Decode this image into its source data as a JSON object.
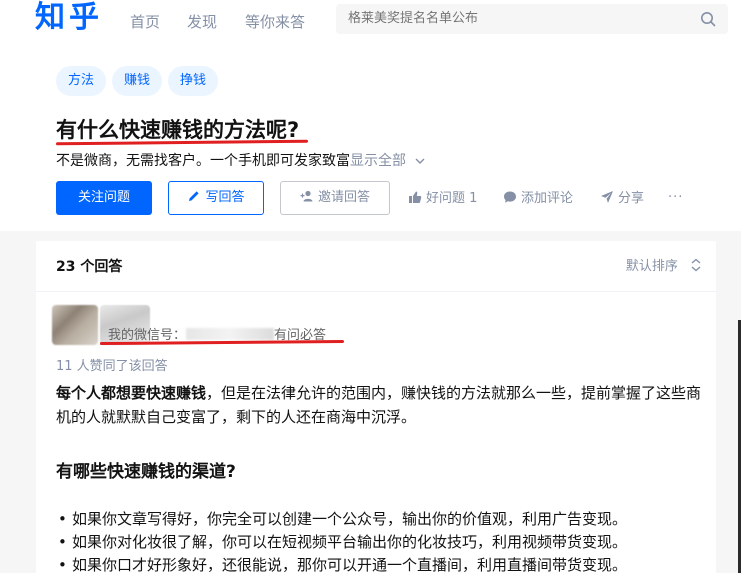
{
  "nav": {
    "logo": "知乎",
    "items": [
      "首页",
      "发现",
      "等你来答"
    ],
    "search_placeholder": "格莱美奖提名名单公布"
  },
  "question": {
    "tags": [
      "方法",
      "赚钱",
      "挣钱"
    ],
    "title": "有什么快速赚钱的方法呢?",
    "description": "不是微商，无需找客户。一个手机即可发家致富",
    "show_all": "显示全部",
    "follow_label": "关注问题",
    "write_label": "写回答",
    "invite_label": "邀请回答",
    "good_question_label": "好问题 1",
    "comment_label": "添加评论",
    "share_label": "分享",
    "more_label": "···"
  },
  "answers": {
    "count_label": "23 个回答",
    "sort_label": "默认排序",
    "first": {
      "bio_prefix": "我的微信号：",
      "bio_suffix": "有问必答",
      "votes": "11 人赞同了该回答",
      "paragraph_bold": "每个人都想要快速赚钱",
      "paragraph_rest": "，但是在法律允许的范围内，赚快钱的方法就那么一些，提前掌握了这些商机的人就默默自己变富了，剩下的人还在商海中沉浮。",
      "heading": "有哪些快速赚钱的渠道?",
      "list": [
        "如果你文章写得好，你完全可以创建一个公众号，输出你的价值观，利用广告变现。",
        "如果你对化妆很了解，你可以在短视频平台输出你的化妆技巧，利用视频带货变现。",
        "如果你口才好形象好，还很能说，那你可以开通一个直播间，利用直播间带货变现。"
      ]
    }
  },
  "colors": {
    "brand": "#0066ff",
    "annotation_red": "#e02020",
    "muted": "#8590a6"
  }
}
